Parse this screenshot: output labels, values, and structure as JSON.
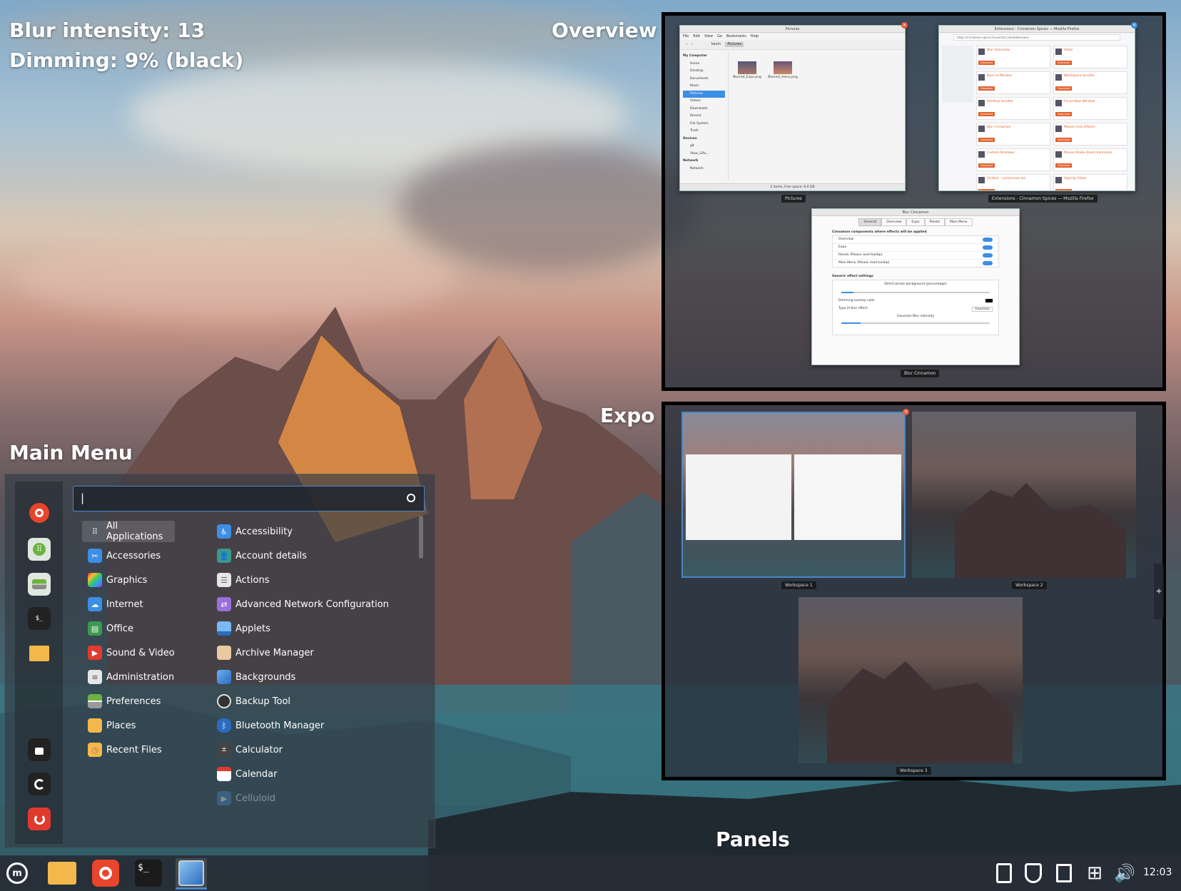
{
  "labels": {
    "blur_intensity": "Blur intensity: 13",
    "dimming": "Dimming: 9% (black)",
    "overview": "Overview",
    "expo": "Expo",
    "main_menu": "Main Menu",
    "panels": "Panels"
  },
  "overview": {
    "file_manager": {
      "title": "Pictures",
      "menu": [
        "File",
        "Edit",
        "View",
        "Go",
        "Bookmarks",
        "Help"
      ],
      "path": [
        "kevin",
        "Pictures"
      ],
      "sidebar_header_computer": "My Computer",
      "sidebar_items": [
        "Home",
        "Desktop",
        "Documents",
        "Music",
        "Pictures",
        "Videos",
        "Downloads",
        "Recent",
        "File System",
        "Trash"
      ],
      "sidebar_header_devices": "Devices",
      "devices": [
        "git",
        "Vbox_GAs..."
      ],
      "sidebar_header_network": "Network",
      "network": [
        "Network"
      ],
      "files": [
        "Blurred_Expo.png",
        "Blurred_menu.png"
      ],
      "status": "2 items, Free space: 9.0 GB",
      "label": "Pictures"
    },
    "firefox": {
      "title": "Extensions - Cinnamon Spices — Mozilla Firefox",
      "url": "https://cinnamon-spices.linuxmint.com/extensions",
      "extensions_left": [
        "Blur Overview",
        "Back to Monitor",
        "Desktop Scroller",
        "Blur Cinnamon",
        "Custom Shadows",
        "Fanfare - Lockscreen art"
      ],
      "extensions_right": [
        "Slider",
        "Workspace Scroller",
        "Focus New Window",
        "Mouse Click Effects",
        "Mouse Shake Zoom Extension",
        "Opacity Slider"
      ],
      "download": "Download",
      "label": "Extensions - Cinnamon Spices — Mozilla Firefox"
    },
    "blur_settings": {
      "title": "Blur Cinnamon",
      "tabs": [
        "General",
        "Overview",
        "Expo",
        "Panels",
        "Main Menu"
      ],
      "section1": "Cinnamon components where effects will be applied",
      "toggles": [
        "Overview",
        "Expo",
        "Panels  (Please read tooltip)",
        "Main Menu  (Please read tooltip)"
      ],
      "section2": "Generic effect settings",
      "dim_label": "Dim/Colorize background (percentage)",
      "dim_color_label": "Dimming overlay color",
      "blur_type_label": "Type of blur effect",
      "blur_type_value": "Gaussian",
      "blur_intensity_label": "Gaussian Blur intensity",
      "label": "Blur Cinnamon"
    }
  },
  "expo": {
    "workspaces": [
      "Workspace 1",
      "Workspace 2",
      "Workspace 3"
    ],
    "add": "+"
  },
  "menu": {
    "search_value": "|",
    "categories": [
      "All Applications",
      "Accessories",
      "Graphics",
      "Internet",
      "Office",
      "Sound & Video",
      "Administration",
      "Preferences",
      "Places",
      "Recent Files"
    ],
    "applications": [
      "Accessibility",
      "Account details",
      "Actions",
      "Advanced Network Configuration",
      "Applets",
      "Archive Manager",
      "Backgrounds",
      "Backup Tool",
      "Bluetooth Manager",
      "Calculator",
      "Calendar",
      "Celluloid"
    ]
  },
  "panel": {
    "clock": "12:03"
  },
  "colors": {
    "accent": "#4a86c5",
    "firefox": "#e8452c",
    "folder": "#f2b84b",
    "download": "#e0622e"
  }
}
